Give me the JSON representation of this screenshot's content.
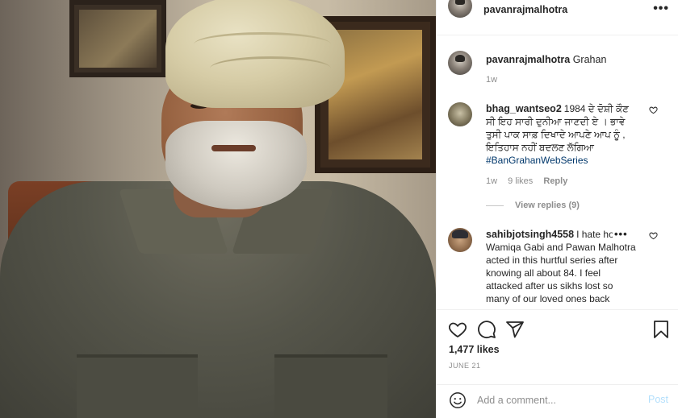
{
  "header": {
    "username": "pavanrajmalhotra",
    "more_icon": "more-horizontal-icon"
  },
  "caption": {
    "username": "pavanrajmalhotra",
    "text": "Grahan",
    "time": "1w"
  },
  "comments": [
    {
      "username": "bhag_wantseo2",
      "text": "1984 ਦੇ ਦੋਸ਼ੀ ਕੌਣ ਸੀ ਇਹ ਸਾਰੀ ਦੁਨੀਆ ਜਾਣਦੀ ਏ । ਭਾਵੇ ਤੁਸੀ ਪਾਕ ਸਾਫ਼ ਦਿਖਾਦੇ ਆਪਣੇ ਆਪ ਨੂੰ , ਇਤਿਹਾਸ ਨਹੀਂ ਬਦਲਣ ਲੱਗਿਆ",
      "hashtag": "#BanGrahanWebSeries",
      "time": "1w",
      "likes": "9 likes",
      "reply_label": "Reply",
      "view_replies": "View replies (9)"
    },
    {
      "username": "sahibjotsingh4558",
      "text": "I hate how Wamiqa Gabi and Pawan Malhotra acted in this hurtful series after knowing all about 84. I feel attacked after us sikhs lost so many of our loved ones back",
      "more_label": "•••"
    }
  ],
  "actions": {
    "likes": "1,477 likes",
    "date": "JUNE 21"
  },
  "add_comment": {
    "placeholder": "Add a comment...",
    "post_label": "Post"
  },
  "colors": {
    "text": "#262626",
    "secondary": "#8e8e8e",
    "hashtag": "#00376b",
    "post_disabled": "#b2dffc",
    "divider": "#efefef"
  }
}
